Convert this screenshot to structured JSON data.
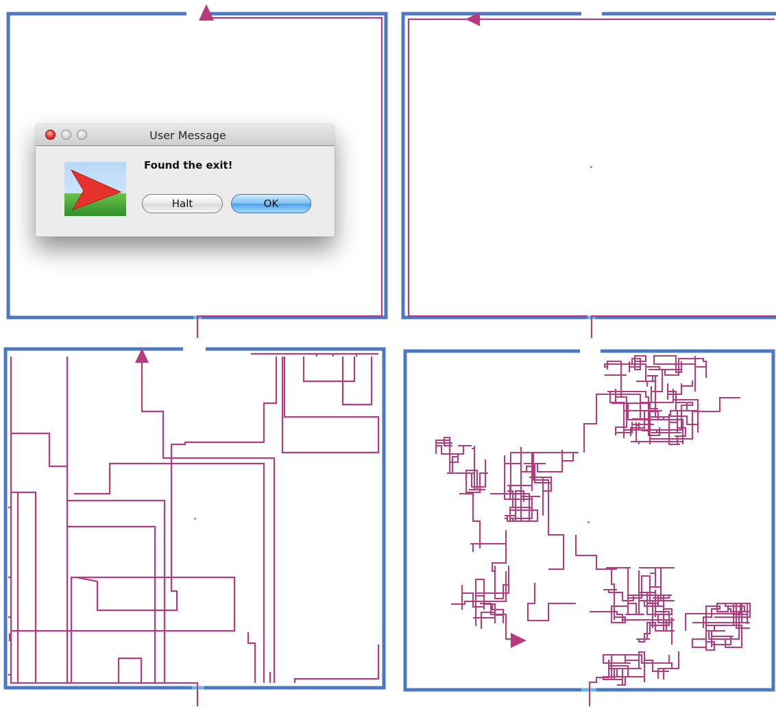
{
  "dialog": {
    "title": "User Message",
    "message": "Found the exit!",
    "halt_label": "Halt",
    "ok_label": "OK"
  },
  "icons": {
    "close": "close-traffic-light-icon",
    "minimize": "minimize-traffic-light-icon",
    "zoom": "zoom-traffic-light-icon",
    "app": "red-arrow-app-icon",
    "path_arrow": "arrowhead-icon"
  },
  "colors": {
    "wall": "#4a78c2",
    "door": "#67b6e3",
    "path": "#b53a7e",
    "dot": "#5ab3e0",
    "ok_button": "#5aa7ef"
  }
}
